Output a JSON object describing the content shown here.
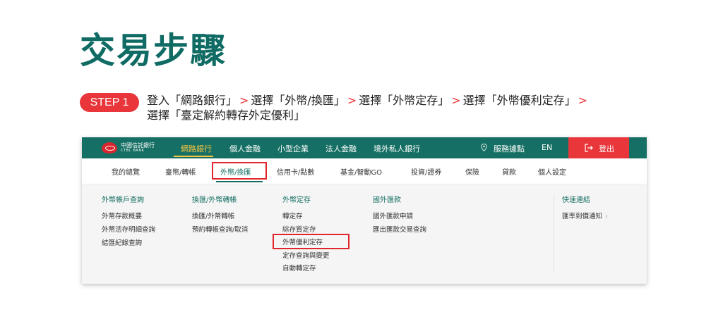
{
  "page": {
    "title": "交易步驟",
    "step_badge": "STEP 1",
    "step_line1_parts": [
      "登入「網路銀行」",
      ">",
      "選擇「外幣/換匯」",
      ">",
      "選擇「外幣定存」",
      ">",
      "選擇「外幣優利定存」",
      ">"
    ],
    "step_line2": "選擇「臺定解約轉存外定優利」"
  },
  "colors": {
    "brand_green": "#166f64",
    "title_green": "#0f6b63",
    "accent_red": "#e8363a",
    "active_yellow": "#f3c442"
  },
  "screenshot": {
    "logo": {
      "cn": "中國信託銀行",
      "en": "CTBC BANK",
      "icon": "ctbc-logo-icon"
    },
    "topnav": [
      "網路銀行",
      "個人金融",
      "小型企業",
      "法人金融",
      "境外私人銀行"
    ],
    "topnav_right": {
      "location_icon": "location-pin-icon",
      "branches": "服務據點",
      "lang": "EN",
      "logout": "登出",
      "logout_icon": "logout-icon"
    },
    "subnav": [
      "我的總覽",
      "臺幣/轉帳",
      "外幣/換匯",
      "信用卡/點數",
      "基金/智動GO",
      "投資/證券",
      "保險",
      "貸款",
      "個人設定"
    ],
    "menu_columns": [
      {
        "title": "外幣帳戶查詢",
        "links": [
          "外幣存款概要",
          "外幣活存明細查詢",
          "結匯紀錄查詢"
        ]
      },
      {
        "title": "換匯/外幣轉帳",
        "links": [
          "換匯/外幣轉帳",
          "預約轉帳查詢/取消"
        ]
      },
      {
        "title": "外幣定存",
        "links": [
          "轉定存",
          "綜存質定存",
          "外幣優利定存",
          "定存查詢與變更",
          "自動轉定存"
        ]
      },
      {
        "title": "國外匯款",
        "links": [
          "國外匯款申請",
          "匯出匯款交易查詢"
        ]
      }
    ],
    "quick_links": {
      "title": "快速連結",
      "links": [
        "匯率到價通知"
      ],
      "chevron": "›"
    }
  }
}
